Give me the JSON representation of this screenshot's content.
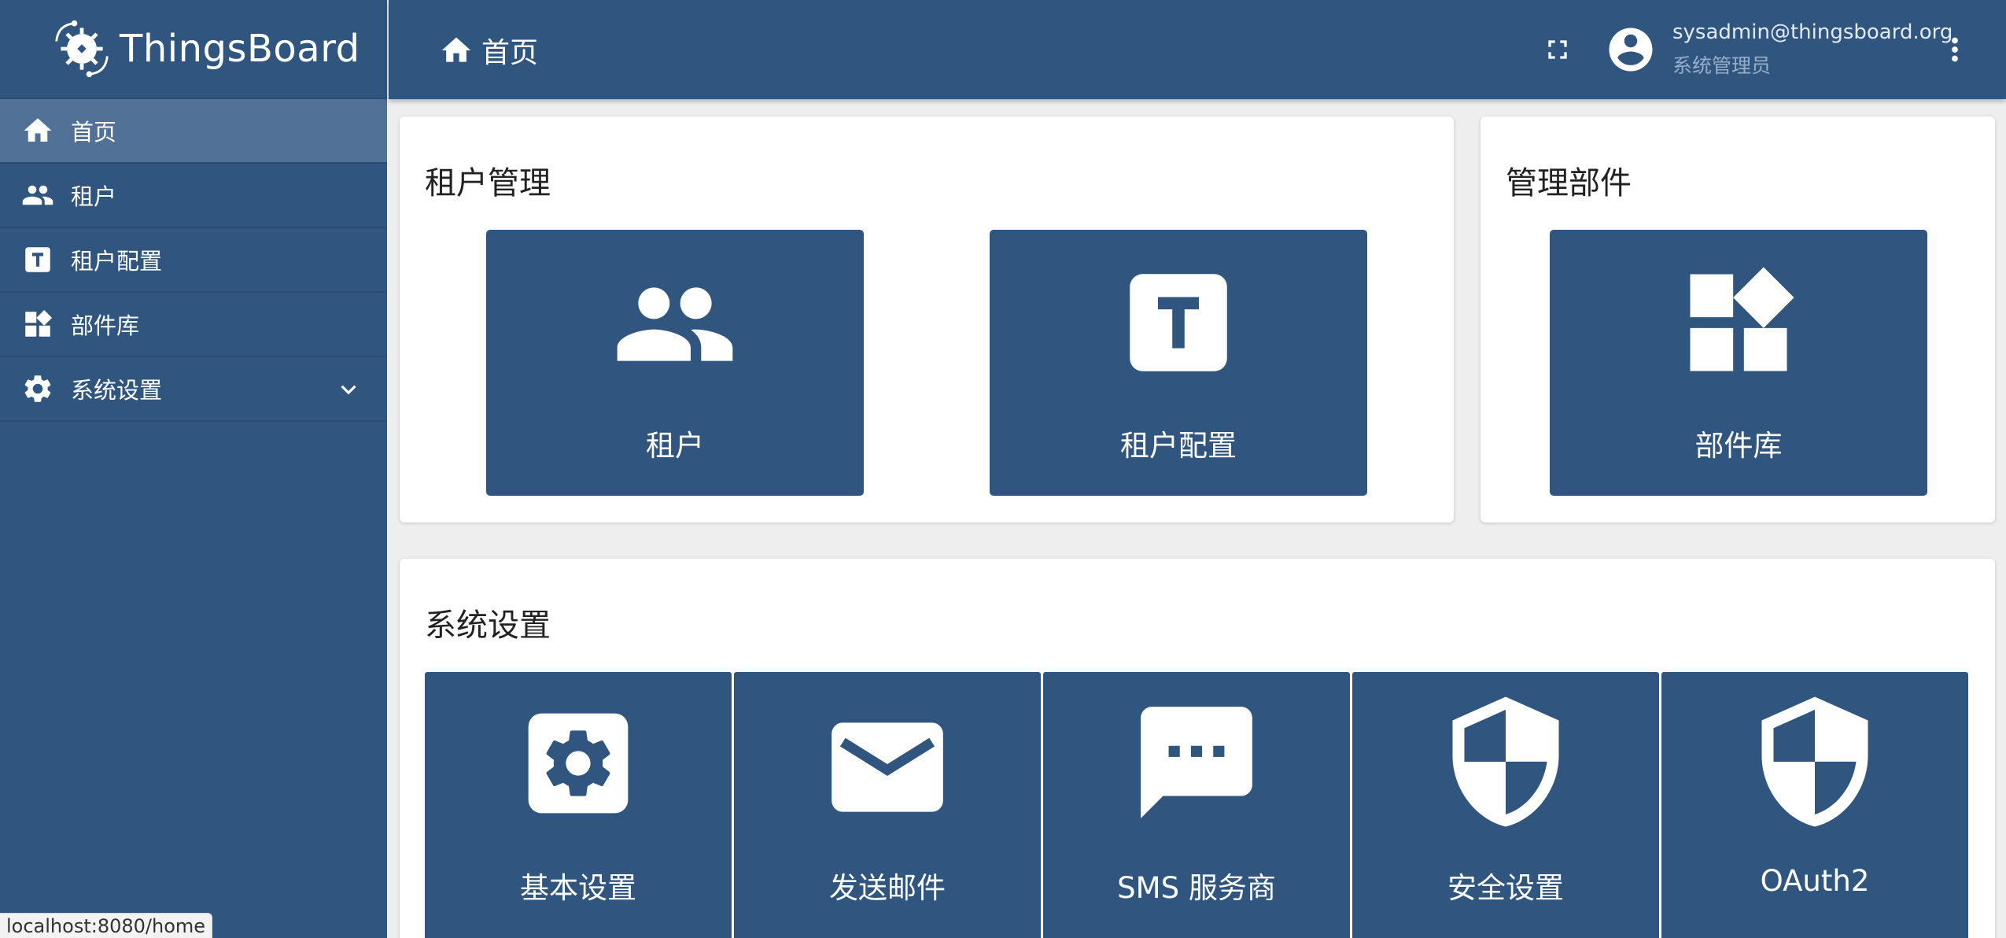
{
  "app": {
    "name": "ThingsBoard"
  },
  "sidebar": {
    "items": [
      {
        "label": "首页",
        "icon": "home-icon",
        "active": true
      },
      {
        "label": "租户",
        "icon": "people-icon"
      },
      {
        "label": "租户配置",
        "icon": "tenant-profile-icon"
      },
      {
        "label": "部件库",
        "icon": "widgets-icon"
      },
      {
        "label": "系统设置",
        "icon": "gear-icon",
        "expandable": true
      }
    ]
  },
  "header": {
    "breadcrumb": "首页",
    "user_email": "sysadmin@thingsboard.org",
    "user_role": "系统管理员"
  },
  "cards": {
    "tenant_mgmt": {
      "title": "租户管理",
      "tiles": [
        {
          "label": "租户",
          "icon": "people-icon"
        },
        {
          "label": "租户配置",
          "icon": "tenant-profile-icon"
        }
      ]
    },
    "widgets_mgmt": {
      "title": "管理部件",
      "tiles": [
        {
          "label": "部件库",
          "icon": "widgets-icon"
        }
      ]
    },
    "system_settings": {
      "title": "系统设置",
      "tiles": [
        {
          "label": "基本设置",
          "icon": "settings-icon"
        },
        {
          "label": "发送邮件",
          "icon": "mail-icon"
        },
        {
          "label": "SMS 服务商",
          "icon": "sms-icon"
        },
        {
          "label": "安全设置",
          "icon": "security-icon"
        },
        {
          "label": "OAuth2",
          "icon": "oauth-icon"
        }
      ]
    }
  },
  "status_bar": {
    "url": "localhost:8080/home"
  },
  "colors": {
    "primary": "#305680",
    "active": "#527196",
    "background": "#eeeeee"
  }
}
